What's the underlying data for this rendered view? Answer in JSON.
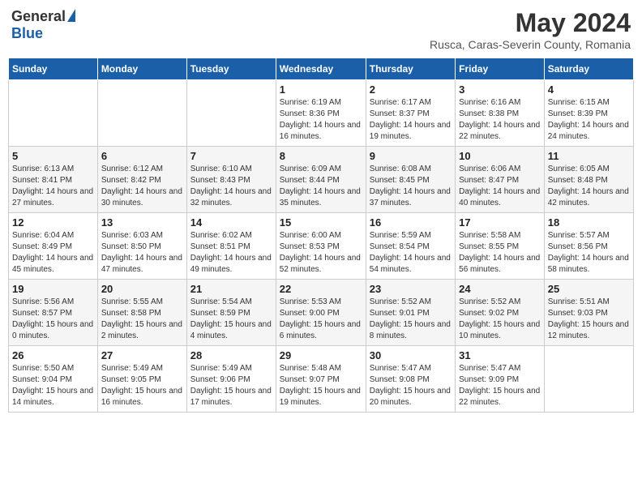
{
  "header": {
    "logo_general": "General",
    "logo_blue": "Blue",
    "title": "May 2024",
    "subtitle": "Rusca, Caras-Severin County, Romania"
  },
  "weekdays": [
    "Sunday",
    "Monday",
    "Tuesday",
    "Wednesday",
    "Thursday",
    "Friday",
    "Saturday"
  ],
  "weeks": [
    [
      {
        "day": "",
        "sunrise": "",
        "sunset": "",
        "daylight": ""
      },
      {
        "day": "",
        "sunrise": "",
        "sunset": "",
        "daylight": ""
      },
      {
        "day": "",
        "sunrise": "",
        "sunset": "",
        "daylight": ""
      },
      {
        "day": "1",
        "sunrise": "Sunrise: 6:19 AM",
        "sunset": "Sunset: 8:36 PM",
        "daylight": "Daylight: 14 hours and 16 minutes."
      },
      {
        "day": "2",
        "sunrise": "Sunrise: 6:17 AM",
        "sunset": "Sunset: 8:37 PM",
        "daylight": "Daylight: 14 hours and 19 minutes."
      },
      {
        "day": "3",
        "sunrise": "Sunrise: 6:16 AM",
        "sunset": "Sunset: 8:38 PM",
        "daylight": "Daylight: 14 hours and 22 minutes."
      },
      {
        "day": "4",
        "sunrise": "Sunrise: 6:15 AM",
        "sunset": "Sunset: 8:39 PM",
        "daylight": "Daylight: 14 hours and 24 minutes."
      }
    ],
    [
      {
        "day": "5",
        "sunrise": "Sunrise: 6:13 AM",
        "sunset": "Sunset: 8:41 PM",
        "daylight": "Daylight: 14 hours and 27 minutes."
      },
      {
        "day": "6",
        "sunrise": "Sunrise: 6:12 AM",
        "sunset": "Sunset: 8:42 PM",
        "daylight": "Daylight: 14 hours and 30 minutes."
      },
      {
        "day": "7",
        "sunrise": "Sunrise: 6:10 AM",
        "sunset": "Sunset: 8:43 PM",
        "daylight": "Daylight: 14 hours and 32 minutes."
      },
      {
        "day": "8",
        "sunrise": "Sunrise: 6:09 AM",
        "sunset": "Sunset: 8:44 PM",
        "daylight": "Daylight: 14 hours and 35 minutes."
      },
      {
        "day": "9",
        "sunrise": "Sunrise: 6:08 AM",
        "sunset": "Sunset: 8:45 PM",
        "daylight": "Daylight: 14 hours and 37 minutes."
      },
      {
        "day": "10",
        "sunrise": "Sunrise: 6:06 AM",
        "sunset": "Sunset: 8:47 PM",
        "daylight": "Daylight: 14 hours and 40 minutes."
      },
      {
        "day": "11",
        "sunrise": "Sunrise: 6:05 AM",
        "sunset": "Sunset: 8:48 PM",
        "daylight": "Daylight: 14 hours and 42 minutes."
      }
    ],
    [
      {
        "day": "12",
        "sunrise": "Sunrise: 6:04 AM",
        "sunset": "Sunset: 8:49 PM",
        "daylight": "Daylight: 14 hours and 45 minutes."
      },
      {
        "day": "13",
        "sunrise": "Sunrise: 6:03 AM",
        "sunset": "Sunset: 8:50 PM",
        "daylight": "Daylight: 14 hours and 47 minutes."
      },
      {
        "day": "14",
        "sunrise": "Sunrise: 6:02 AM",
        "sunset": "Sunset: 8:51 PM",
        "daylight": "Daylight: 14 hours and 49 minutes."
      },
      {
        "day": "15",
        "sunrise": "Sunrise: 6:00 AM",
        "sunset": "Sunset: 8:53 PM",
        "daylight": "Daylight: 14 hours and 52 minutes."
      },
      {
        "day": "16",
        "sunrise": "Sunrise: 5:59 AM",
        "sunset": "Sunset: 8:54 PM",
        "daylight": "Daylight: 14 hours and 54 minutes."
      },
      {
        "day": "17",
        "sunrise": "Sunrise: 5:58 AM",
        "sunset": "Sunset: 8:55 PM",
        "daylight": "Daylight: 14 hours and 56 minutes."
      },
      {
        "day": "18",
        "sunrise": "Sunrise: 5:57 AM",
        "sunset": "Sunset: 8:56 PM",
        "daylight": "Daylight: 14 hours and 58 minutes."
      }
    ],
    [
      {
        "day": "19",
        "sunrise": "Sunrise: 5:56 AM",
        "sunset": "Sunset: 8:57 PM",
        "daylight": "Daylight: 15 hours and 0 minutes."
      },
      {
        "day": "20",
        "sunrise": "Sunrise: 5:55 AM",
        "sunset": "Sunset: 8:58 PM",
        "daylight": "Daylight: 15 hours and 2 minutes."
      },
      {
        "day": "21",
        "sunrise": "Sunrise: 5:54 AM",
        "sunset": "Sunset: 8:59 PM",
        "daylight": "Daylight: 15 hours and 4 minutes."
      },
      {
        "day": "22",
        "sunrise": "Sunrise: 5:53 AM",
        "sunset": "Sunset: 9:00 PM",
        "daylight": "Daylight: 15 hours and 6 minutes."
      },
      {
        "day": "23",
        "sunrise": "Sunrise: 5:52 AM",
        "sunset": "Sunset: 9:01 PM",
        "daylight": "Daylight: 15 hours and 8 minutes."
      },
      {
        "day": "24",
        "sunrise": "Sunrise: 5:52 AM",
        "sunset": "Sunset: 9:02 PM",
        "daylight": "Daylight: 15 hours and 10 minutes."
      },
      {
        "day": "25",
        "sunrise": "Sunrise: 5:51 AM",
        "sunset": "Sunset: 9:03 PM",
        "daylight": "Daylight: 15 hours and 12 minutes."
      }
    ],
    [
      {
        "day": "26",
        "sunrise": "Sunrise: 5:50 AM",
        "sunset": "Sunset: 9:04 PM",
        "daylight": "Daylight: 15 hours and 14 minutes."
      },
      {
        "day": "27",
        "sunrise": "Sunrise: 5:49 AM",
        "sunset": "Sunset: 9:05 PM",
        "daylight": "Daylight: 15 hours and 16 minutes."
      },
      {
        "day": "28",
        "sunrise": "Sunrise: 5:49 AM",
        "sunset": "Sunset: 9:06 PM",
        "daylight": "Daylight: 15 hours and 17 minutes."
      },
      {
        "day": "29",
        "sunrise": "Sunrise: 5:48 AM",
        "sunset": "Sunset: 9:07 PM",
        "daylight": "Daylight: 15 hours and 19 minutes."
      },
      {
        "day": "30",
        "sunrise": "Sunrise: 5:47 AM",
        "sunset": "Sunset: 9:08 PM",
        "daylight": "Daylight: 15 hours and 20 minutes."
      },
      {
        "day": "31",
        "sunrise": "Sunrise: 5:47 AM",
        "sunset": "Sunset: 9:09 PM",
        "daylight": "Daylight: 15 hours and 22 minutes."
      },
      {
        "day": "",
        "sunrise": "",
        "sunset": "",
        "daylight": ""
      }
    ]
  ]
}
